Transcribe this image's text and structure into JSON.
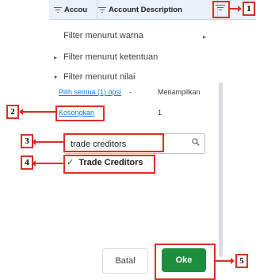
{
  "header": {
    "col1_label": "Accou",
    "col2_label": "Account Description"
  },
  "menu": {
    "filter_by_color": "Filter menurut warna",
    "filter_by_condition": "Filter menurut ketentuan",
    "filter_by_value": "Filter menurut nilai"
  },
  "values": {
    "select_all": "Pilih semua (1) opsi",
    "select_sep": "-",
    "showing": "Menampilkan",
    "clear": "Kosongkan",
    "count": "1",
    "search_value": "trade creditors",
    "options": [
      {
        "label": "Trade Creditors",
        "checked": true
      }
    ]
  },
  "buttons": {
    "cancel": "Batal",
    "ok": "Oke"
  },
  "annotations": [
    "1",
    "2",
    "3",
    "4",
    "5"
  ],
  "colors": {
    "annotation": "#d93025",
    "ok_button": "#1e8e3e",
    "link": "#1a73e8",
    "header_bg": "#eaf1fb"
  }
}
